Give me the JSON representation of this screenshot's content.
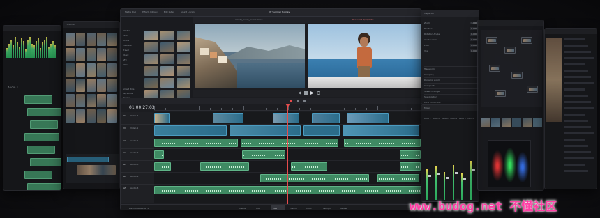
{
  "app": {
    "title": "My Summer Holiday",
    "timecode": "01:00:27:03",
    "product_label": "DaVinci Resolve 16",
    "clip_name": "Amalfi_Coast_Aerial Drone",
    "record_label": "Recorded 4/22/2019"
  },
  "header_left": [
    "Media Pool",
    "Effects Library",
    "Edit Index",
    "Sound Library"
  ],
  "media_pool": {
    "bins": [
      "Master",
      "Stills",
      "Drone",
      "Portraits",
      "Travel",
      "Music",
      "SFX",
      "Titles"
    ],
    "smart_bins": [
      "Smart Bins",
      "Keywords",
      "People"
    ]
  },
  "tracks": [
    {
      "label": "V2",
      "name": "Video 2",
      "kind": "video"
    },
    {
      "label": "V1",
      "name": "Video 1",
      "kind": "video"
    },
    {
      "label": "A1",
      "name": "Audio 1",
      "kind": "audio"
    },
    {
      "label": "A2",
      "name": "Audio 2",
      "kind": "audio"
    },
    {
      "label": "A3",
      "name": "Audio 3",
      "kind": "audio"
    },
    {
      "label": "A4",
      "name": "Audio 4",
      "kind": "audio"
    },
    {
      "label": "A5",
      "name": "Audio 5",
      "kind": "audio"
    }
  ],
  "inspector": {
    "title": "Inspector",
    "sections": [
      "Transform",
      "Cropping",
      "Dynamic Zoom",
      "Composite",
      "Speed Change",
      "Stabilization",
      "Lens Correction"
    ],
    "fields": [
      {
        "label": "Zoom",
        "value": "1.000"
      },
      {
        "label": "Position",
        "value": "0.000"
      },
      {
        "label": "Rotation Angle",
        "value": "0.000"
      },
      {
        "label": "Anchor Point",
        "value": "0.000"
      },
      {
        "label": "Pitch",
        "value": "0.000"
      },
      {
        "label": "Yaw",
        "value": "0.000"
      }
    ]
  },
  "mixer": {
    "title": "Mixer",
    "channels": [
      "Audio 1",
      "Audio 2",
      "Audio 3",
      "Audio 4",
      "Audio 5",
      "Main 1"
    ],
    "levels": [
      0.55,
      0.6,
      0.5,
      0.62,
      0.48,
      0.7
    ]
  },
  "page_tabs": [
    "Media",
    "Cut",
    "Edit",
    "Fusion",
    "Color",
    "Fairlight",
    "Deliver"
  ],
  "active_tab": "Edit",
  "left_panel": {
    "title": "Timeline",
    "track_header": "Audio 1"
  },
  "watermark": "www.budog.net 不懂社区",
  "colors": {
    "accent": "#e64c4c",
    "audio_clip": "#3f8a63",
    "video_clip": "#2b6c8a",
    "watermark": "#ff3fa4"
  }
}
